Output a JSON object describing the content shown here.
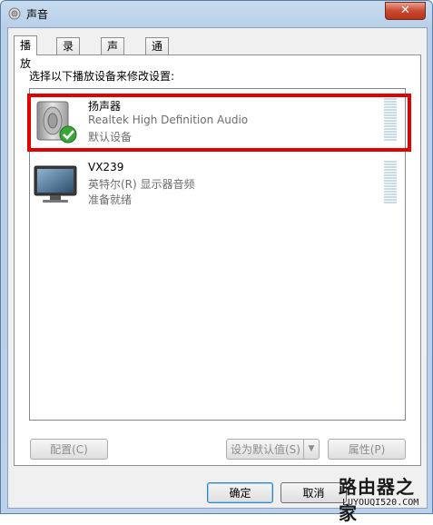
{
  "window": {
    "title": "声音",
    "close_label": "✕"
  },
  "tabs": [
    {
      "label": "播放",
      "active": true
    },
    {
      "label": "录制",
      "active": false
    },
    {
      "label": "声音",
      "active": false
    },
    {
      "label": "通信",
      "active": false
    }
  ],
  "playback": {
    "instruction": "选择以下播放设备来修改设置:",
    "devices": [
      {
        "name": "扬声器",
        "description": "Realtek High Definition Audio",
        "status": "默认设备",
        "icon": "speaker-icon",
        "default": true,
        "highlighted": true
      },
      {
        "name": "VX239",
        "description": "英特尔(R) 显示器音频",
        "status": "准备就绪",
        "icon": "monitor-icon",
        "default": false,
        "highlighted": false
      }
    ]
  },
  "panel_buttons": {
    "configure": "配置(C)",
    "set_default": "设为默认值(S)",
    "properties": "属性(P)"
  },
  "dialog_buttons": {
    "ok": "确定",
    "cancel": "取消"
  },
  "watermark": {
    "main": "路由器之家",
    "url": "LUYOUQI520.COM"
  },
  "colors": {
    "highlight": "#e30000",
    "close": "#c9492f",
    "meter": "#c7dcea"
  }
}
